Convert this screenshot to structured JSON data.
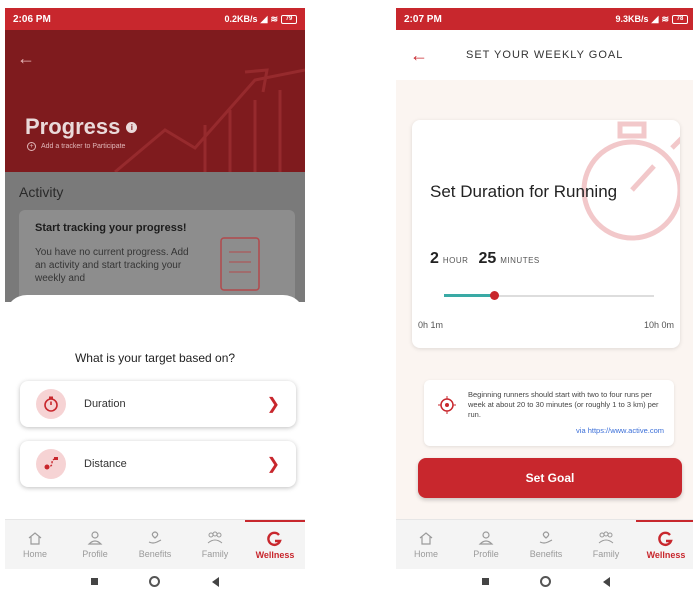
{
  "left": {
    "status": {
      "time": "2:06 PM",
      "speed": "0.2KB/s",
      "battery": "79"
    },
    "hero": {
      "title": "Progress",
      "info_icon": "info-icon",
      "subtitle": "Add a tracker to Participate"
    },
    "activity": {
      "heading": "Activity",
      "card_title": "Start tracking your progress!",
      "card_body": "You have no current progress. Add an activity and start tracking your weekly and"
    },
    "sheet": {
      "question": "What is your target based on?",
      "options": [
        {
          "label": "Duration",
          "icon": "stopwatch-icon"
        },
        {
          "label": "Distance",
          "icon": "route-icon"
        }
      ]
    },
    "nav": [
      {
        "label": "Home",
        "icon": "home-icon"
      },
      {
        "label": "Profile",
        "icon": "profile-icon"
      },
      {
        "label": "Benefits",
        "icon": "benefits-icon"
      },
      {
        "label": "Family",
        "icon": "family-icon"
      },
      {
        "label": "Wellness",
        "icon": "wellness-logo-icon",
        "active": true
      }
    ]
  },
  "right": {
    "status": {
      "time": "2:07 PM",
      "speed": "9.3KB/s",
      "battery": "78"
    },
    "header": {
      "title": "SET YOUR WEEKLY GOAL"
    },
    "goal": {
      "title": "Set Duration for Running",
      "hours": "2",
      "hour_unit": "HOUR",
      "minutes": "25",
      "minute_unit": "MINUTES",
      "slider_fraction": 0.24,
      "min_label": "0h 1m",
      "max_label": "10h 0m"
    },
    "tip": {
      "text": "Beginning runners should start with two to four runs per week at about 20 to 30 minutes (or roughly 1 to 3 km) per run.",
      "link": "via https://www.active.com"
    },
    "button": {
      "label": "Set Goal"
    },
    "nav": [
      {
        "label": "Home",
        "icon": "home-icon"
      },
      {
        "label": "Profile",
        "icon": "profile-icon"
      },
      {
        "label": "Benefits",
        "icon": "benefits-icon"
      },
      {
        "label": "Family",
        "icon": "family-icon"
      },
      {
        "label": "Wellness",
        "icon": "wellness-logo-icon",
        "active": true
      }
    ]
  },
  "colors": {
    "brand_red": "#c8272d",
    "slider_teal": "#3aaaa5",
    "link_blue": "#3b6fd8"
  }
}
